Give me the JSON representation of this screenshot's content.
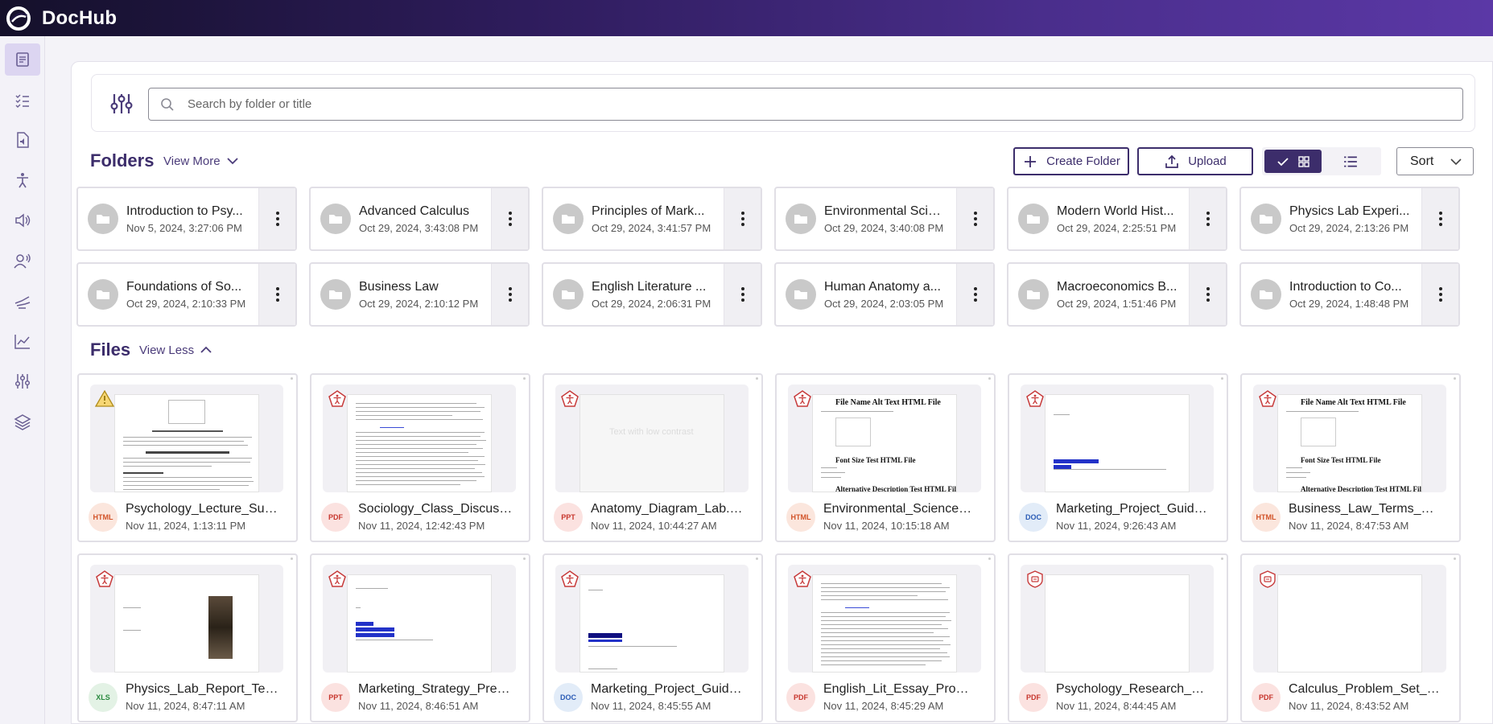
{
  "app": {
    "name": "DocHub"
  },
  "colors": {
    "brand": "#3c2d6b",
    "header_start": "#14102a",
    "header_end": "#5b38a6",
    "accent_light": "#dcd5f1"
  },
  "sidebar": {
    "items": [
      {
        "icon": "document-icon",
        "active": true
      },
      {
        "icon": "checklist-icon",
        "active": false
      },
      {
        "icon": "audio-file-icon",
        "active": false
      },
      {
        "icon": "accessibility-icon",
        "active": false
      },
      {
        "icon": "speaker-icon",
        "active": false
      },
      {
        "icon": "voice-icon",
        "active": false
      },
      {
        "icon": "sign-language-icon",
        "active": false
      },
      {
        "icon": "analytics-icon",
        "active": false
      },
      {
        "icon": "sliders-icon",
        "active": false
      },
      {
        "icon": "layers-icon",
        "active": false
      }
    ]
  },
  "search": {
    "placeholder": "Search by folder or title",
    "value": ""
  },
  "folders": {
    "title": "Folders",
    "toggle_label": "View More",
    "items": [
      {
        "name": "Introduction to Psy...",
        "date": "Nov 5, 2024, 3:27:06 PM"
      },
      {
        "name": "Advanced Calculus",
        "date": "Oct 29, 2024, 3:43:08 PM"
      },
      {
        "name": "Principles of Mark...",
        "date": "Oct 29, 2024, 3:41:57 PM"
      },
      {
        "name": "Environmental Scie...",
        "date": "Oct 29, 2024, 3:40:08 PM"
      },
      {
        "name": "Modern World Hist...",
        "date": "Oct 29, 2024, 2:25:51 PM"
      },
      {
        "name": "Physics Lab Experi...",
        "date": "Oct 29, 2024, 2:13:26 PM"
      },
      {
        "name": "Foundations of So...",
        "date": "Oct 29, 2024, 2:10:33 PM"
      },
      {
        "name": "Business Law",
        "date": "Oct 29, 2024, 2:10:12 PM"
      },
      {
        "name": "English Literature ...",
        "date": "Oct 29, 2024, 2:06:31 PM"
      },
      {
        "name": "Human Anatomy a...",
        "date": "Oct 29, 2024, 2:03:05 PM"
      },
      {
        "name": "Macroeconomics B...",
        "date": "Oct 29, 2024, 1:51:46 PM"
      },
      {
        "name": "Introduction to Co...",
        "date": "Oct 29, 2024, 1:48:48 PM"
      }
    ]
  },
  "toolbar": {
    "create_folder_label": "Create Folder",
    "upload_label": "Upload",
    "sort_label": "Sort",
    "view_mode": "grid"
  },
  "files": {
    "title": "Files",
    "toggle_label": "View Less",
    "items": [
      {
        "name": "Psychology_Lecture_Sum...",
        "date": "Nov 11, 2024, 1:13:11 PM",
        "type": "HTML",
        "status": "warning-icon"
      },
      {
        "name": "Sociology_Class_Discussi...",
        "date": "Nov 11, 2024, 12:42:43 PM",
        "type": "PDF",
        "status": "accessibility-badge-icon"
      },
      {
        "name": "Anatomy_Diagram_Lab.p...",
        "date": "Nov 11, 2024, 10:44:27 AM",
        "type": "PPT",
        "status": "accessibility-badge-icon",
        "thumb_text": "Text with low contrast"
      },
      {
        "name": "Environmental_Science_R...",
        "date": "Nov 11, 2024, 10:15:18 AM",
        "type": "HTML",
        "status": "accessibility-badge-icon",
        "thumb_heading1": "File Name Alt Text HTML File",
        "thumb_heading2": "Font Size Test HTML File",
        "thumb_heading3": "Alternative Description Test HTML File"
      },
      {
        "name": "Marketing_Project_Guidel...",
        "date": "Nov 11, 2024, 9:26:43 AM",
        "type": "DOC",
        "status": "accessibility-badge-icon"
      },
      {
        "name": "Business_Law_Terms_Glo...",
        "date": "Nov 11, 2024, 8:47:53 AM",
        "type": "HTML",
        "status": "accessibility-badge-icon",
        "thumb_heading1": "File Name Alt Text HTML File",
        "thumb_heading2": "Font Size Test HTML File",
        "thumb_heading3": "Alternative Description Test HTML File"
      },
      {
        "name": "Physics_Lab_Report_Tem...",
        "date": "Nov 11, 2024, 8:47:11 AM",
        "type": "XLS",
        "status": "accessibility-badge-icon"
      },
      {
        "name": "Marketing_Strategy_Pres...",
        "date": "Nov 11, 2024, 8:46:51 AM",
        "type": "PPT",
        "status": "accessibility-badge-icon"
      },
      {
        "name": "Marketing_Project_Guidel...",
        "date": "Nov 11, 2024, 8:45:55 AM",
        "type": "DOC",
        "status": "accessibility-badge-icon"
      },
      {
        "name": "English_Lit_Essay_Prompt...",
        "date": "Nov 11, 2024, 8:45:29 AM",
        "type": "PDF",
        "status": "accessibility-badge-icon"
      },
      {
        "name": "Psychology_Research_Ar...",
        "date": "Nov 11, 2024, 8:44:45 AM",
        "type": "PDF",
        "status": "processing-badge-icon"
      },
      {
        "name": "Calculus_Problem_Set_1....",
        "date": "Nov 11, 2024, 8:43:52 AM",
        "type": "PDF",
        "status": "processing-badge-icon"
      }
    ]
  }
}
